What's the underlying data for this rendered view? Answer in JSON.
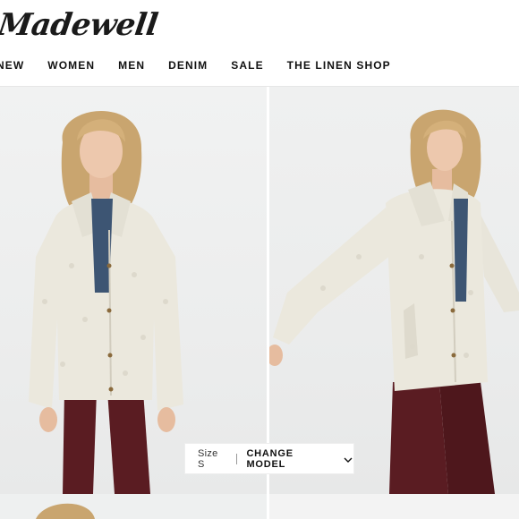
{
  "brand": {
    "logo_text": "Madewell"
  },
  "nav": {
    "items": [
      {
        "label": "NEW"
      },
      {
        "label": "WOMEN"
      },
      {
        "label": "MEN"
      },
      {
        "label": "DENIM"
      },
      {
        "label": "SALE"
      },
      {
        "label": "THE LINEN SHOP"
      }
    ]
  },
  "product": {
    "size_label": "Size S",
    "change_model_label": "CHANGE MODEL",
    "images": [
      {
        "name": "model-front-view"
      },
      {
        "name": "model-side-view"
      }
    ]
  },
  "colors": {
    "coat": "#ebe8dd",
    "pants": "#5a1c22",
    "shirt": "#3d5573",
    "hair": "#c9a56f",
    "skin": "#e9c2a6"
  },
  "icons": {
    "change_model": "chevron-down-icon"
  }
}
